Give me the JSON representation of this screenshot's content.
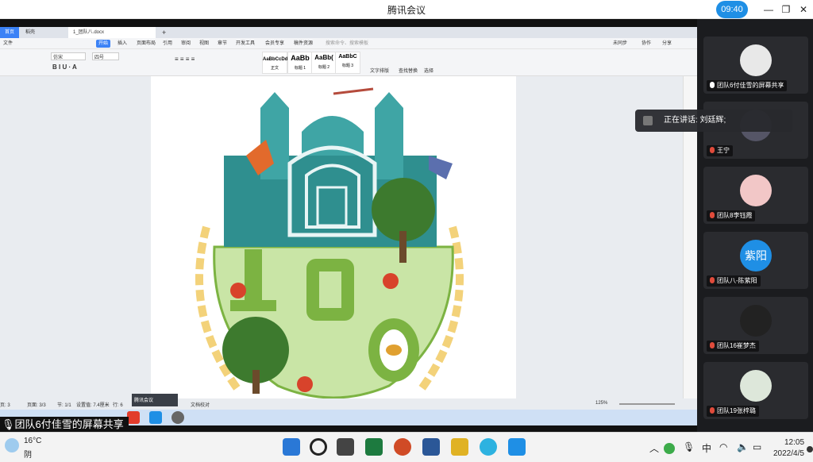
{
  "app": {
    "title": "腾讯会议",
    "time": "09:40"
  },
  "wps": {
    "tabs": [
      "首页",
      "稻壳",
      "1_团队八.docx"
    ],
    "menu": [
      "文件",
      "开始",
      "插入",
      "页面布局",
      "引用",
      "审阅",
      "视图",
      "章节",
      "开发工具",
      "会员专享",
      "稿件资源",
      "搜索命令、搜索模板"
    ],
    "menu_right": [
      "未同步",
      "协作",
      "分享"
    ],
    "font": "仿宋",
    "size": "四号",
    "styles": [
      {
        "sample": "AaBbCcDd",
        "name": "正文"
      },
      {
        "sample": "AaBb",
        "name": "标题 1"
      },
      {
        "sample": "AaBb(",
        "name": "标题 2"
      },
      {
        "sample": "AaBbC",
        "name": "标题 3"
      }
    ],
    "tools": [
      "文字排版",
      "查找替换",
      "选择"
    ],
    "status": [
      "页: 3",
      "页面: 3/3",
      "节: 1/1",
      "设置值: 7.4厘米",
      "行: 6",
      "列: 17"
    ],
    "zoom": "125%",
    "doc_check": "文档校对",
    "popup": "腾讯会议",
    "badge_logo": "100"
  },
  "share_label": "团队6付佳雪的屏幕共享",
  "speaking": "正在讲话: 刘廷辉;",
  "participants": [
    {
      "name": "团队6付佳雪的屏幕共享"
    },
    {
      "name": "王宁"
    },
    {
      "name": "团队8李钰霞"
    },
    {
      "name": "团队八-陈紫阳",
      "avatar_text": "紫阳"
    },
    {
      "name": "团队16崔梦杰"
    },
    {
      "name": "团队19张梓璐"
    }
  ],
  "taskbar": {
    "weather_temp": "16°C",
    "weather_desc": "阴",
    "ime": "中",
    "time": "12:05",
    "date": "2022/4/5"
  },
  "colors": {
    "accent": "#1f8fe5",
    "teal": "#2f8f8f",
    "green": "#7cb342",
    "gold": "#f3d27a"
  }
}
